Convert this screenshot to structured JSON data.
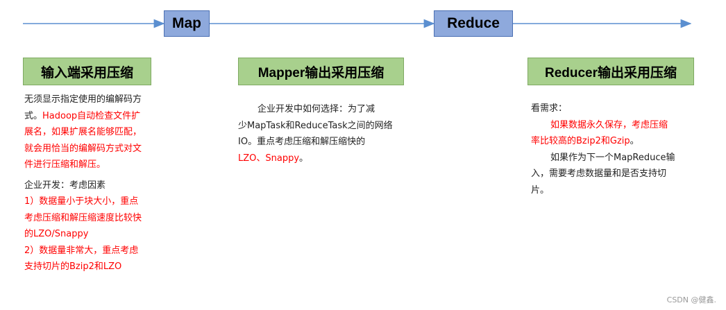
{
  "stages": {
    "map": "Map",
    "reduce": "Reduce"
  },
  "columns": {
    "input": {
      "header": "输入端采用压缩",
      "lines": [
        {
          "text": "无须显示指定使用的编解码方",
          "color": "black"
        },
        {
          "text": "式。",
          "color": "black",
          "inline_next": true
        },
        {
          "text": "Hadoop自动检查文件扩",
          "color": "red"
        },
        {
          "text": "展名，如果扩展名能够匹配，",
          "color": "red"
        },
        {
          "text": "就会用恰当的编解码方式对文",
          "color": "red"
        },
        {
          "text": "件进行压缩和解压。",
          "color": "red"
        }
      ],
      "section2_title": "企业开发：考虑因素",
      "section2_lines": [
        "1）数据量小于块大小，重点",
        "考虑压缩和解压缩速度比较快",
        "的LZO/Snappy",
        "2）数据量非常大，重点考虑",
        "支持切片的Bzip2和LZO"
      ]
    },
    "mapper": {
      "header": "Mapper输出采用压缩",
      "line1": "企业开发中如何选择：为了减",
      "line2": "少MapTask和ReduceTask之间的网络",
      "line3": "IO。重点考虑压缩和解压缩快的",
      "line4_red": "LZO、Snappy",
      "line4_tail": "。"
    },
    "reducer": {
      "header": "Reducer输出采用压缩",
      "title": "看需求：",
      "red1": "如果数据永久保存，考虑压缩",
      "red2": "率比较高的Bzip2和Gzip",
      "red2_tail": "。",
      "line3": "如果作为下一个MapReduce输",
      "line4": "入，需要考虑数据量和是否支持切",
      "line5": "片。"
    }
  },
  "watermark": "CSDN @健鑫.",
  "colors": {
    "stage_fill": "#8ea9dc",
    "header_fill": "#a8d08d",
    "arrow": "#5b8fd0",
    "highlight": "#ff0000"
  }
}
